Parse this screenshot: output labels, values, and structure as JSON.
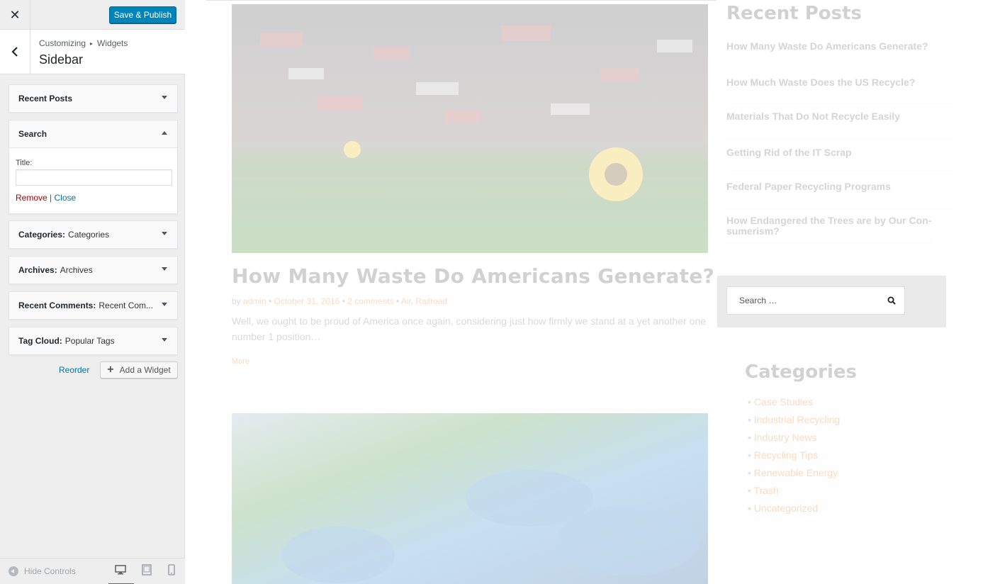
{
  "topbar": {
    "close_glyph": "✕",
    "publish_label": "Save & Publish"
  },
  "section": {
    "crumb_root": "Customizing",
    "crumb_separator": "▸",
    "crumb_child": "Widgets",
    "title": "Sidebar"
  },
  "widgets": [
    {
      "title": "Recent Posts",
      "subtitle": "",
      "expanded": false
    },
    {
      "title": "Search",
      "subtitle": "",
      "expanded": true
    },
    {
      "title": "Categories:",
      "subtitle": "Categories",
      "expanded": false
    },
    {
      "title": "Archives:",
      "subtitle": "Archives",
      "expanded": false
    },
    {
      "title": "Recent Comments:",
      "subtitle": "Recent Com...",
      "expanded": false
    },
    {
      "title": "Tag Cloud:",
      "subtitle": "Popular Tags",
      "expanded": false
    }
  ],
  "search_widget": {
    "field_label": "Title:",
    "title_value": "",
    "remove_label": "Remove",
    "divider": "|",
    "close_label": "Close"
  },
  "actions": {
    "reorder_label": "Reorder",
    "add_widget_label": "Add a Widget"
  },
  "footer": {
    "hide_controls_label": "Hide Controls",
    "active_device": "desktop"
  },
  "preview": {
    "post": {
      "title": "How Many Waste Do Americans Generate?",
      "by": "by",
      "author": "admin",
      "date": "October 31, 2016",
      "comments": "2 comments",
      "cat_1": "Air",
      "cat_sep": ",",
      "cat_2": "Railroad",
      "excerpt": "Well, we ought to be proud of America once again, considering just how firmly we stand at a yet another one number 1 position…",
      "more": "More"
    },
    "recent_posts": {
      "title": "Recent Posts",
      "items": [
        "How Many Waste Do Americans Generate?",
        "How Much Waste Does the US Recycle?",
        "Materials That Do Not Recycle Easily",
        "Getting Rid of the IT Scrap",
        "Federal Paper Recycling Programs",
        "How Endangered the Trees are by Our Con-sumerism?"
      ]
    },
    "search": {
      "placeholder": "Search …"
    },
    "categories": {
      "title": "Categories",
      "items": [
        "Case Studies",
        "Industrial Recycling",
        "Industry News",
        "Recycling Tips",
        "Renewable Energy",
        "Trash",
        "Uncategorized"
      ]
    }
  },
  "colors": {
    "accent": "#0085ba",
    "link": "#0073aa",
    "remove": "#aa0000",
    "theme_orange": "#f07d1b"
  }
}
